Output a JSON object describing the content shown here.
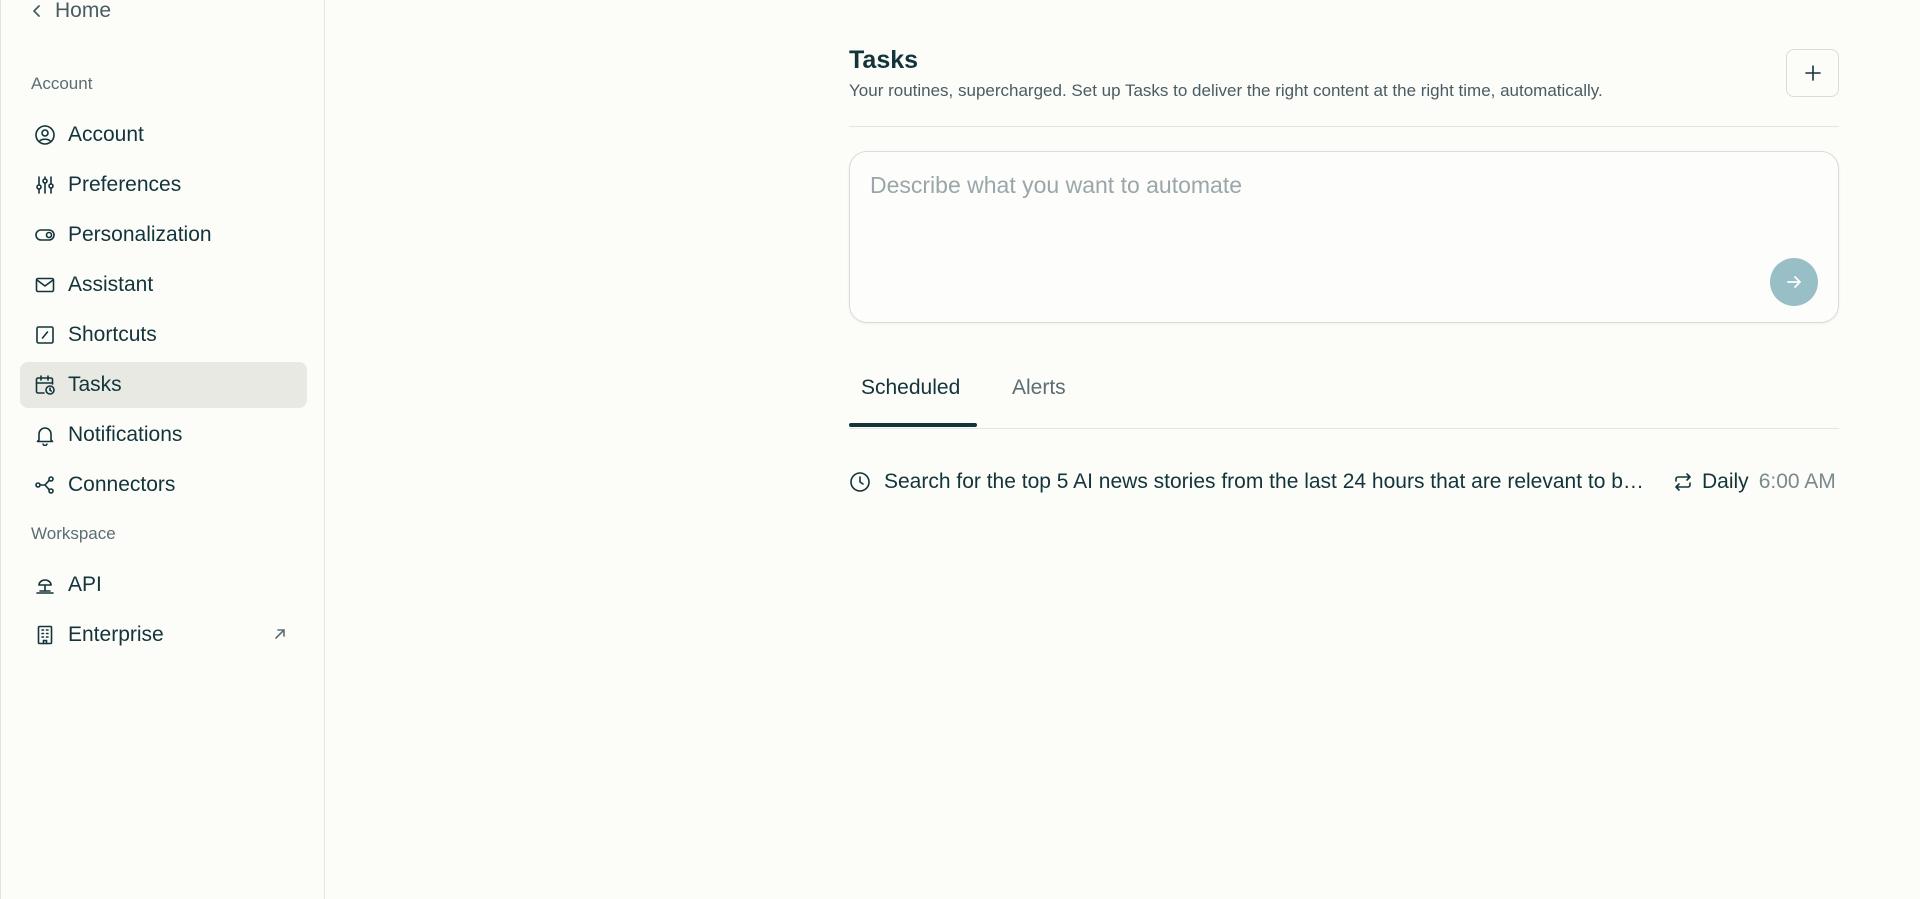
{
  "sidebar": {
    "back_label": "Home",
    "sections": {
      "account_label": "Account",
      "workspace_label": "Workspace"
    },
    "items": [
      {
        "label": "Account",
        "icon": "user-circle-icon"
      },
      {
        "label": "Preferences",
        "icon": "sliders-icon"
      },
      {
        "label": "Personalization",
        "icon": "toggle-icon"
      },
      {
        "label": "Assistant",
        "icon": "mail-icon"
      },
      {
        "label": "Shortcuts",
        "icon": "shortcut-icon"
      },
      {
        "label": "Tasks",
        "icon": "calendar-clock-icon",
        "active": true
      },
      {
        "label": "Notifications",
        "icon": "bell-icon"
      },
      {
        "label": "Connectors",
        "icon": "connectors-icon"
      }
    ],
    "workspace_items": [
      {
        "label": "API",
        "icon": "api-icon"
      },
      {
        "label": "Enterprise",
        "icon": "building-icon",
        "external": true
      }
    ]
  },
  "main": {
    "title": "Tasks",
    "subtitle": "Your routines, supercharged. Set up Tasks to deliver the right content at the right time, automatically.",
    "composer": {
      "placeholder": "Describe what you want to automate"
    },
    "tabs": [
      {
        "label": "Scheduled",
        "active": true
      },
      {
        "label": "Alerts",
        "active": false
      }
    ],
    "tasks": [
      {
        "text": "Search for the top 5 AI news stories from the last 24 hours that are relevant to b…",
        "frequency": "Daily",
        "time": "6:00 AM"
      }
    ]
  },
  "colors": {
    "background": "#fcfcf9",
    "text": "#13343b",
    "active_item_bg": "#e9e9e3",
    "send_button": "#98bfc6"
  }
}
